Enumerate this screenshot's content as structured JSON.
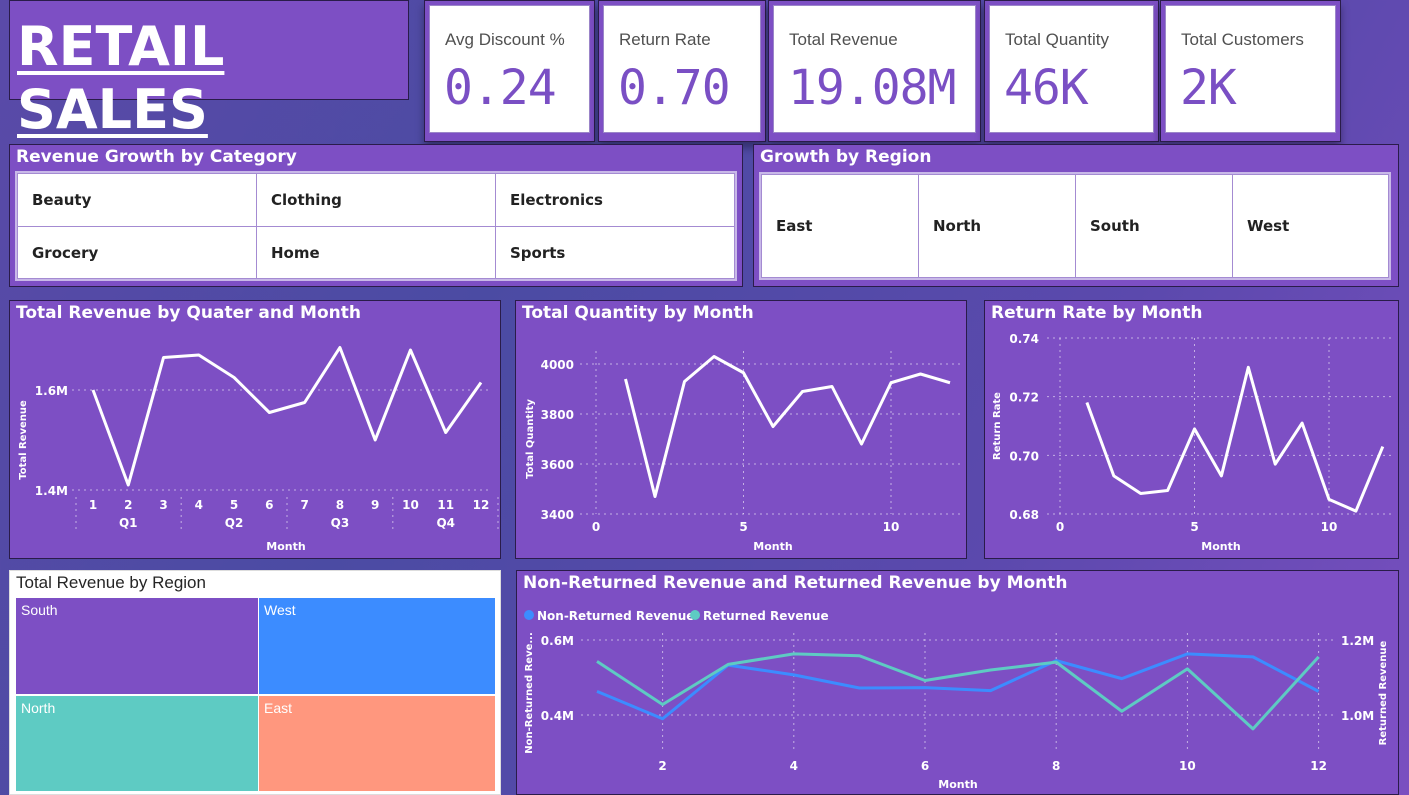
{
  "header": {
    "title": "RETAIL SALES"
  },
  "kpis": [
    {
      "label": "Avg Discount %",
      "value": "0.24"
    },
    {
      "label": "Return Rate",
      "value": "0.70"
    },
    {
      "label": "Total Revenue",
      "value": "19.08M"
    },
    {
      "label": "Total Quantity",
      "value": "46K"
    },
    {
      "label": "Total Customers",
      "value": "2K"
    }
  ],
  "category_panel": {
    "title": "Revenue Growth by Category",
    "items": [
      "Beauty",
      "Clothing",
      "Electronics",
      "Grocery",
      "Home",
      "Sports"
    ]
  },
  "region_panel": {
    "title": "Growth by Region",
    "items": [
      "East",
      "North",
      "South",
      "West"
    ]
  },
  "colors": {
    "panel": "#7d4fc4",
    "line": "#ffffff",
    "series_blue": "#3c8cff",
    "series_teal": "#5ecbc3",
    "treemap_south": "#7d4fc4",
    "treemap_west": "#3c8cff",
    "treemap_north": "#5ecbc3",
    "treemap_east": "#ff977e"
  },
  "treemap": {
    "title": "Total Revenue by Region",
    "cells": [
      "South",
      "West",
      "North",
      "East"
    ]
  },
  "chart_data": [
    {
      "type": "line",
      "title": "Total Revenue by Quater and Month",
      "xlabel": "Month",
      "ylabel": "Total Revenue",
      "x": [
        1,
        2,
        3,
        4,
        5,
        6,
        7,
        8,
        9,
        10,
        11,
        12
      ],
      "groups": [
        "Q1",
        "Q2",
        "Q3",
        "Q4"
      ],
      "values": [
        1.6,
        1.41,
        1.665,
        1.67,
        1.625,
        1.555,
        1.575,
        1.685,
        1.5,
        1.68,
        1.515,
        1.615
      ],
      "ytick_labels": [
        "1.4M",
        "1.6M"
      ],
      "ylim": [
        1.4,
        1.6
      ]
    },
    {
      "type": "line",
      "title": "Total Quantity by Month",
      "xlabel": "Month",
      "ylabel": "Total Quantity",
      "x": [
        1,
        2,
        3,
        4,
        5,
        6,
        7,
        8,
        9,
        10,
        11,
        12
      ],
      "values": [
        3940,
        3470,
        3930,
        4030,
        3965,
        3750,
        3890,
        3910,
        3680,
        3925,
        3960,
        3925
      ],
      "yticks": [
        3400,
        3600,
        3800,
        4000
      ],
      "xticks": [
        0,
        5,
        10
      ],
      "ylim": [
        3400,
        4000
      ]
    },
    {
      "type": "line",
      "title": "Return Rate by Month",
      "xlabel": "Month",
      "ylabel": "Return Rate",
      "x": [
        1,
        2,
        3,
        4,
        5,
        6,
        7,
        8,
        9,
        10,
        11,
        12
      ],
      "values": [
        0.718,
        0.693,
        0.687,
        0.688,
        0.709,
        0.693,
        0.73,
        0.697,
        0.711,
        0.685,
        0.681,
        0.703
      ],
      "yticks": [
        "0.68",
        "0.70",
        "0.72",
        "0.74"
      ],
      "xticks": [
        0,
        5,
        10
      ],
      "ylim": [
        0.68,
        0.74
      ]
    },
    {
      "type": "line",
      "title": "Non-Returned Revenue and Returned Revenue by Month",
      "xlabel": "Month",
      "ylabel_left": "Non-Returned Reve...",
      "ylabel_right": "Returned Revenue",
      "x": [
        1,
        2,
        3,
        4,
        5,
        6,
        7,
        8,
        9,
        10,
        11,
        12
      ],
      "xticks": [
        2,
        4,
        6,
        8,
        10,
        12
      ],
      "left_ticks": [
        "0.4M",
        "0.6M"
      ],
      "left_ylim": [
        0.4,
        0.6
      ],
      "right_ticks": [
        "1.0M",
        "1.2M"
      ],
      "right_ylim": [
        1.0,
        1.2
      ],
      "series": [
        {
          "name": "Non-Returned Revenue",
          "axis": "left",
          "values": [
            0.463,
            0.39,
            0.533,
            0.507,
            0.472,
            0.473,
            0.465,
            0.545,
            0.497,
            0.563,
            0.555,
            0.463
          ]
        },
        {
          "name": "Returned Revenue",
          "axis": "right",
          "values": [
            1.143,
            1.028,
            1.135,
            1.163,
            1.158,
            1.092,
            1.12,
            1.141,
            1.01,
            1.123,
            0.963,
            1.155
          ]
        }
      ]
    }
  ]
}
